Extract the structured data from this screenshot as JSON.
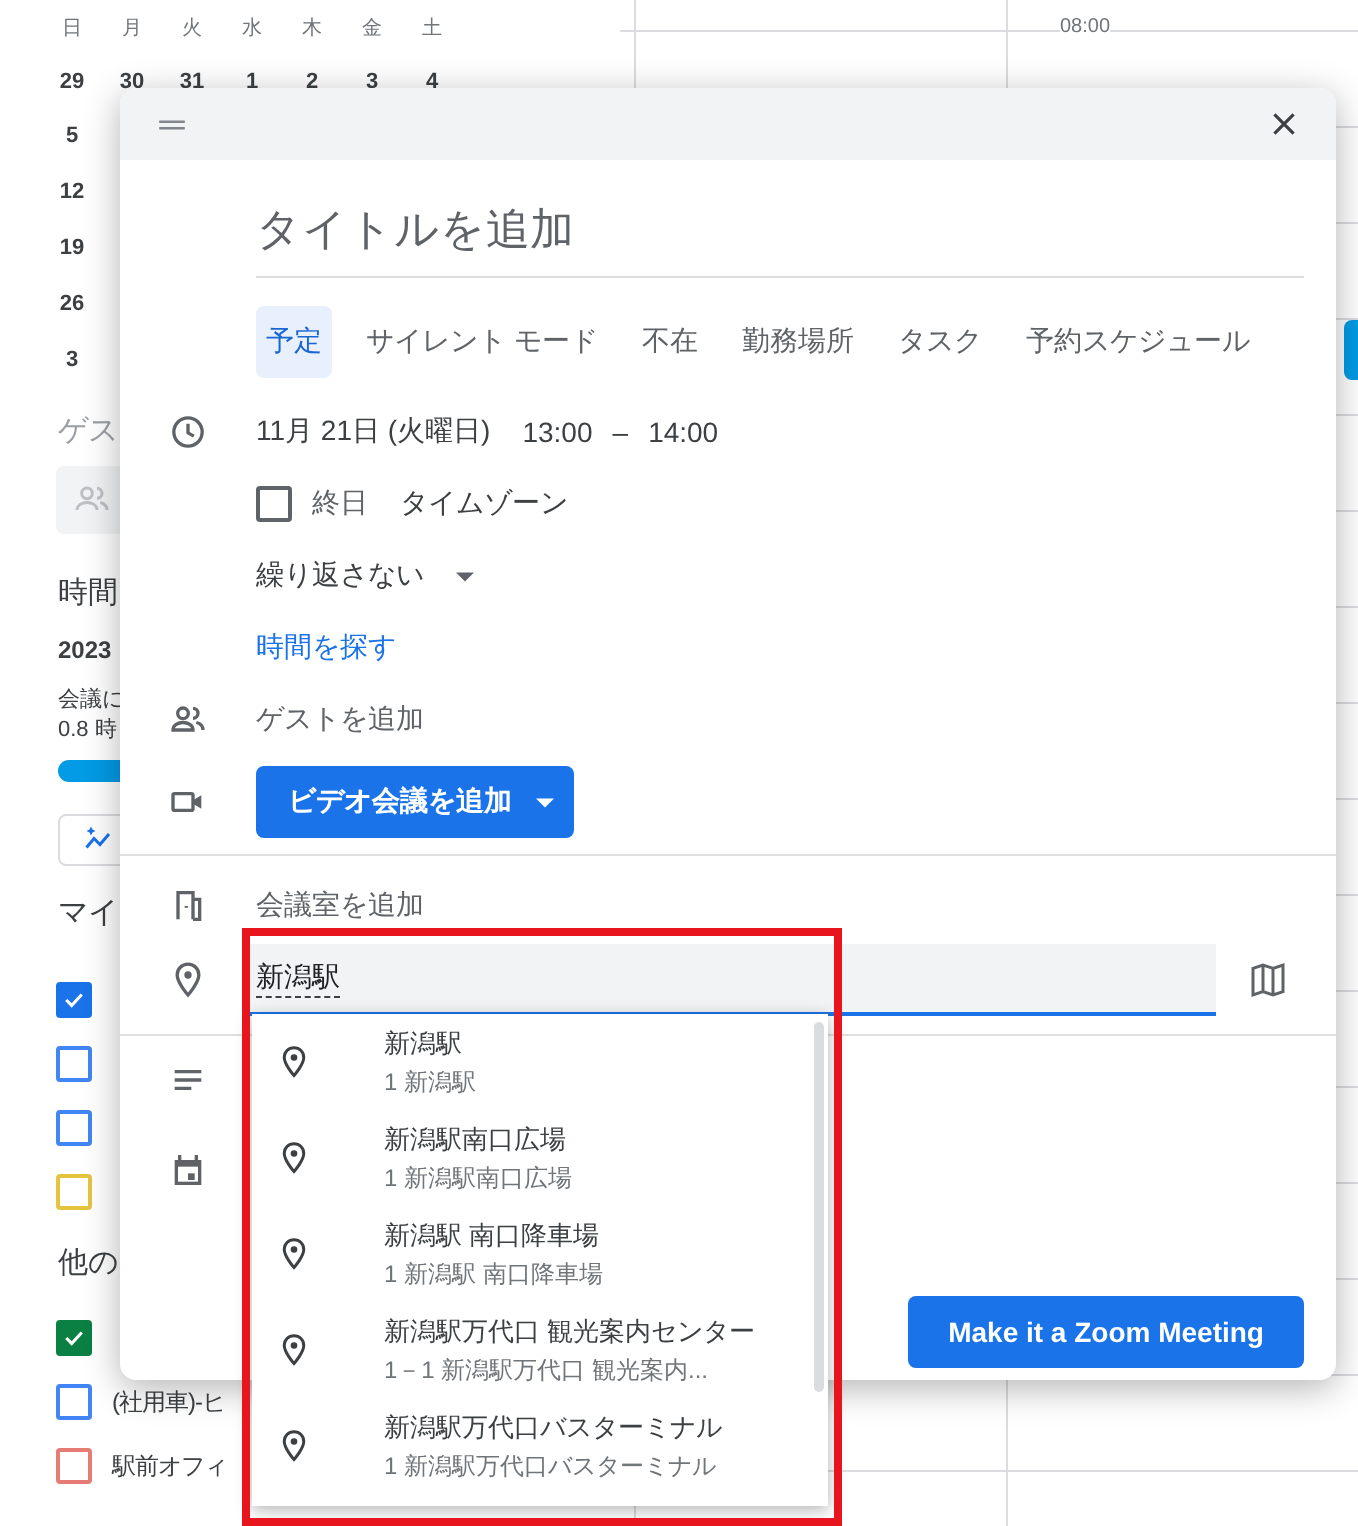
{
  "mini_calendar": {
    "weekdays": [
      "日",
      "月",
      "火",
      "水",
      "木",
      "金",
      "土"
    ],
    "first_week": [
      "29",
      "30",
      "31",
      "1",
      "2",
      "3",
      "4"
    ],
    "first_column": [
      "5",
      "12",
      "19",
      "26",
      "3"
    ]
  },
  "time_label": "08:00",
  "sidebar": {
    "guests_heading": "ゲス",
    "time_heading": "時間",
    "year": "2023",
    "meeting_text": "会議に",
    "hours": "0.8 時",
    "my_calendars_heading": "マイ",
    "my_calendars": [
      {
        "checked": true,
        "color": "#1a73e8"
      },
      {
        "checked": false,
        "color": "#4285f4"
      },
      {
        "checked": false,
        "color": "#4285f4"
      },
      {
        "checked": false,
        "color": "#e4c441"
      }
    ],
    "other_heading": "他の",
    "other_calendars": [
      {
        "checked": true,
        "color": "#0b8043"
      },
      {
        "checked": false,
        "color": "#4285f4",
        "label": "(社用車)-ヒ"
      },
      {
        "checked": false,
        "color": "#e67c73",
        "label": "駅前オフィ"
      }
    ]
  },
  "dialog": {
    "title_placeholder": "タイトルを追加",
    "tabs": [
      {
        "label": "予定",
        "selected": true
      },
      {
        "label": "サイレント モード",
        "selected": false
      },
      {
        "label": "不在",
        "selected": false
      },
      {
        "label": "勤務場所",
        "selected": false
      },
      {
        "label": "タスク",
        "selected": false
      },
      {
        "label": "予約スケジュール",
        "selected": false
      }
    ],
    "date": "11月 21日 (火曜日)",
    "start": "13:00",
    "dash": "–",
    "end": "14:00",
    "all_day": {
      "label": "終日",
      "checked": false
    },
    "timezone": "タイムゾーン",
    "recurrence": "繰り返さない",
    "find_time": "時間を探す",
    "guests_placeholder": "ゲストを追加",
    "video_button": "ビデオ会議を追加",
    "room": "会議室を追加",
    "location": "新潟駅",
    "zoom_button": "Make it a Zoom Meeting"
  },
  "suggestions": [
    {
      "name": "新潟駅",
      "address": "1 新潟駅"
    },
    {
      "name": "新潟駅南口広場",
      "address": "1 新潟駅南口広場"
    },
    {
      "name": "新潟駅 南口降車場",
      "address": "1 新潟駅 南口降車場"
    },
    {
      "name": "新潟駅万代口 観光案内センター",
      "address": "1－1 新潟駅万代口 観光案内..."
    },
    {
      "name": "新潟駅万代口バスターミナル",
      "address": "1 新潟駅万代口バスターミナル"
    }
  ]
}
